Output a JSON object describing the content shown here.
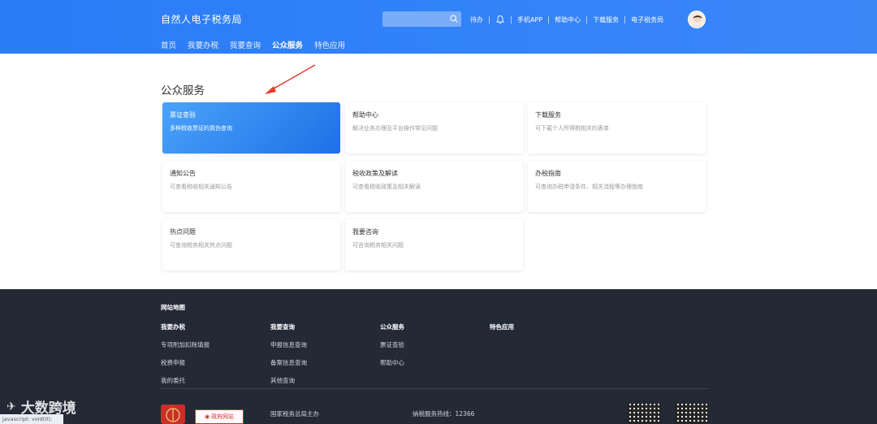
{
  "header": {
    "brand": "自然人电子税务局",
    "nav": [
      "首页",
      "我要办税",
      "我要查询",
      "公众服务",
      "特色应用"
    ],
    "search_placeholder": "",
    "links": [
      "待办",
      "手机APP",
      "帮助中心",
      "下载服务",
      "电子税务局"
    ]
  },
  "main": {
    "section_title": "公众服务",
    "cards": [
      {
        "title": "票证查验",
        "desc": "多种税收票证的真伪查询"
      },
      {
        "title": "帮助中心",
        "desc": "解决业务办理及平台操作常见问题"
      },
      {
        "title": "下载服务",
        "desc": "可下载个人所得税相关的表单"
      },
      {
        "title": "通知公告",
        "desc": "可查看税收相关通知公告"
      },
      {
        "title": "税收政策及解读",
        "desc": "可查看税收政策及相关解读"
      },
      {
        "title": "办税指南",
        "desc": "可查询办税申请条件、相关流程等办理指南"
      },
      {
        "title": "热点问题",
        "desc": "可查询税务相关热点问题"
      },
      {
        "title": "我要咨询",
        "desc": "可咨询税务相关问题"
      }
    ]
  },
  "footer": {
    "map_title": "网站地图",
    "columns": [
      {
        "heading": "我要办税",
        "links": [
          "专项附加扣除填报",
          "税费申报",
          "我的委托"
        ]
      },
      {
        "heading": "我要查询",
        "links": [
          "申报信息查询",
          "备案信息查询",
          "其他查询"
        ]
      },
      {
        "heading": "公众服务",
        "links": [
          "票证查验",
          "帮助中心"
        ]
      },
      {
        "heading": "特色应用",
        "links": []
      }
    ],
    "host": "国家税务总局主办",
    "hotline": "纳税服务热线：12366",
    "gov_badge": "政府网站"
  },
  "watermark": "大数跨境",
  "status": "javascript: void(0);"
}
